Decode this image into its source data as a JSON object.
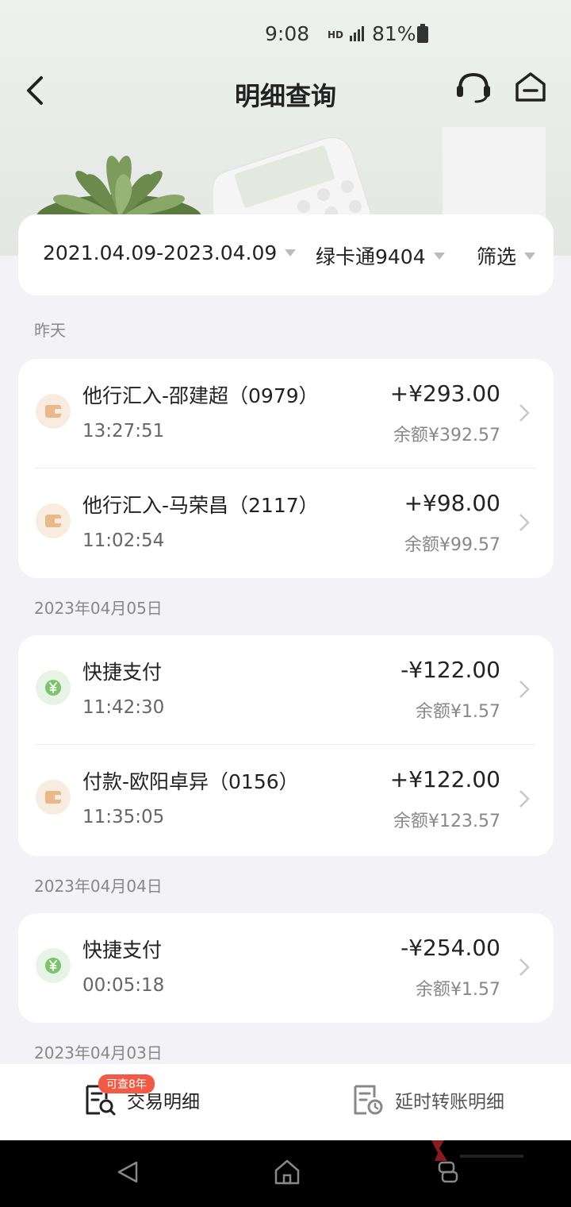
{
  "status_bar": {
    "time": "9:08",
    "network": "HD",
    "battery": "81%"
  },
  "nav": {
    "title": "明细查询",
    "back_icon": "chevron-left-icon",
    "service_icon": "headset-icon",
    "home_icon": "home-icon"
  },
  "filters": {
    "date_range": "2021.04.09-2023.04.09",
    "account": "绿卡通9404",
    "filter": "筛选"
  },
  "sections": [
    {
      "label": "昨天",
      "items": [
        {
          "title": "他行汇入-邵建超（0979）",
          "time": "13:27:51",
          "amount": "+¥293.00",
          "balance": "余额¥392.57",
          "icon": "wallet-icon"
        },
        {
          "title": "他行汇入-马荣昌（2117）",
          "time": "11:02:54",
          "amount": "+¥98.00",
          "balance": "余额¥99.57",
          "icon": "wallet-icon"
        }
      ]
    },
    {
      "label": "2023年04月05日",
      "items": [
        {
          "title": "快捷支付",
          "time": "11:42:30",
          "amount": "-¥122.00",
          "balance": "余额¥1.57",
          "icon": "yuan-icon"
        },
        {
          "title": "付款-欧阳卓异（0156）",
          "time": "11:35:05",
          "amount": "+¥122.00",
          "balance": "余额¥123.57",
          "icon": "wallet-icon"
        }
      ]
    },
    {
      "label": "2023年04月04日",
      "items": [
        {
          "title": "快捷支付",
          "time": "00:05:18",
          "amount": "-¥254.00",
          "balance": "余额¥1.57",
          "icon": "yuan-icon"
        }
      ]
    },
    {
      "label": "2023年04月03日",
      "items": []
    }
  ],
  "tabs": {
    "transactions": "交易明细",
    "badge": "可查8年",
    "delayed": "延时转账明细"
  },
  "colors": {
    "wallet_icon": "#e9b98a",
    "yuan_icon": "#7cc36a",
    "badge": "#f15b45"
  }
}
